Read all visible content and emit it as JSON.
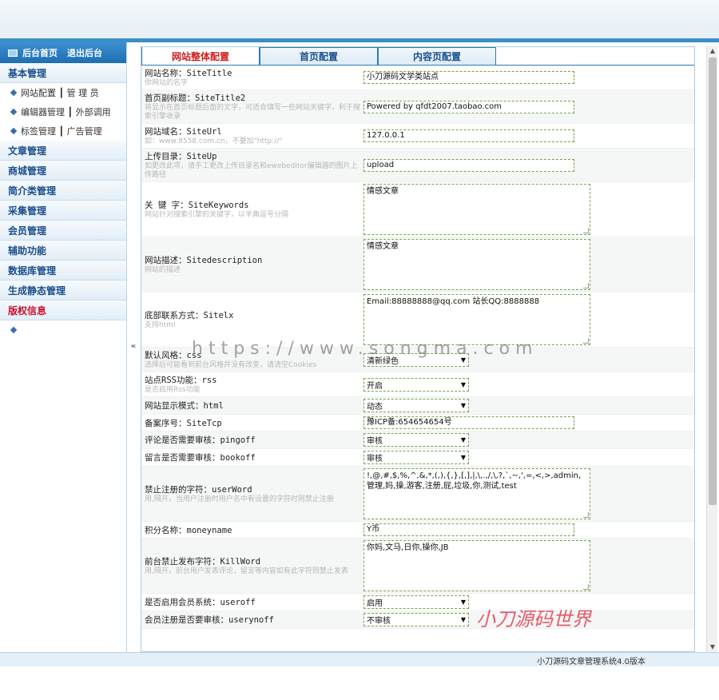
{
  "sidebar": {
    "head": {
      "home": "后台首页",
      "logout": "退出后台"
    },
    "groups": [
      {
        "label": "基本管理",
        "subs": [
          "网站配置 ┃ 管 理 员",
          "编辑器管理 ┃ 外部调用",
          "标签管理 ┃ 广告管理"
        ]
      },
      {
        "label": "文章管理"
      },
      {
        "label": "商城管理"
      },
      {
        "label": "简介类管理"
      },
      {
        "label": "采集管理"
      },
      {
        "label": "会员管理"
      },
      {
        "label": "辅助功能"
      },
      {
        "label": "数据库管理"
      },
      {
        "label": "生成静态管理"
      },
      {
        "label": "版权信息"
      }
    ],
    "collapse": "«"
  },
  "tabs": [
    "网站整体配置",
    "首页配置",
    "内容页配置"
  ],
  "rows": [
    {
      "label": "网站名称：SiteTitle",
      "hint": "你网站的名字",
      "type": "input",
      "value": "小刀源码文学类站点"
    },
    {
      "label": "首页副标题：SiteTitle2",
      "hint": "将显示在首页标题后面的文字，可适合填写一些网站关键字，利于搜索引擎收录",
      "type": "input",
      "value": "Powered by qfdt2007.taobao.com"
    },
    {
      "label": "网站域名：SiteUrl",
      "hint": "如：www.8558.com.cn，不要加\"http://\"",
      "type": "input",
      "value": "127.0.0.1"
    },
    {
      "label": "上传目录：SiteUp",
      "hint": "如更改此项，请手工更改上传目录名和ewebeditor编辑器的图片上传路径",
      "type": "input",
      "value": "upload"
    },
    {
      "label": "关 键 字：SiteKeywords",
      "hint": "网站针对搜索引擎的关键字，以半角逗号分隔",
      "type": "textarea",
      "value": "情感文章",
      "h": 64
    },
    {
      "label": "网站描述：Sitedescription",
      "hint": "网站的描述",
      "type": "textarea",
      "value": "情感文章",
      "h": 64
    },
    {
      "label": "底部联系方式：Sitelx",
      "hint": "支持html",
      "type": "textarea",
      "value": "Email:88888888@qq.com 站长QQ:8888888",
      "h": 64
    },
    {
      "label": "默认风格：css",
      "hint": "选择后可能看到前台风格并没有改变，请清空Cookies",
      "type": "select",
      "value": "清新绿色"
    },
    {
      "label": "站点RSS功能：rss",
      "hint": "是否启用Rss功能",
      "type": "select",
      "value": "开启"
    },
    {
      "label": "网站显示模式：html",
      "hint": "",
      "type": "select",
      "value": "动态"
    },
    {
      "label": "备案序号：SiteTcp",
      "hint": "",
      "type": "input",
      "value": "豫ICP备:654654654号"
    },
    {
      "label": "评论是否需要审核：pingoff",
      "hint": "",
      "type": "select",
      "value": "审核"
    },
    {
      "label": "留言是否需要审核：bookoff",
      "hint": "",
      "type": "select",
      "value": "审核"
    },
    {
      "label": "禁止注册的字符：userWord",
      "hint": "用,隔开，当用户注册时用户名中有设置的字符时则禁止注册",
      "type": "textarea",
      "value": "!,@,#,$,%,^,&,*,(,),{,},[,],|,\\,.,/,\\,?,`,~,',=,<,>,admin,管理,妈,操,游客,注册,屁,垃圾,你,测试,test",
      "h": 64
    },
    {
      "label": "积分名称：moneyname",
      "hint": "",
      "type": "input",
      "value": "Y币"
    },
    {
      "label": "前台禁止发布字符：KillWord",
      "hint": "用,隔开，前台用户发表评论，留言等内容如有此字符则禁止发表",
      "type": "textarea",
      "value": "你妈,文马,日你,操你,JB",
      "h": 64
    },
    {
      "label": "是否启用会员系统：useroff",
      "hint": "",
      "type": "select",
      "value": "启用"
    },
    {
      "label": "会员注册是否要审核：userynoff",
      "hint": "",
      "type": "select",
      "value": "不审核"
    }
  ],
  "footer": "小刀源码文章管理系统4.0版本",
  "watermark": "https://www.songma.com",
  "watermark2": "小刀源码世界"
}
